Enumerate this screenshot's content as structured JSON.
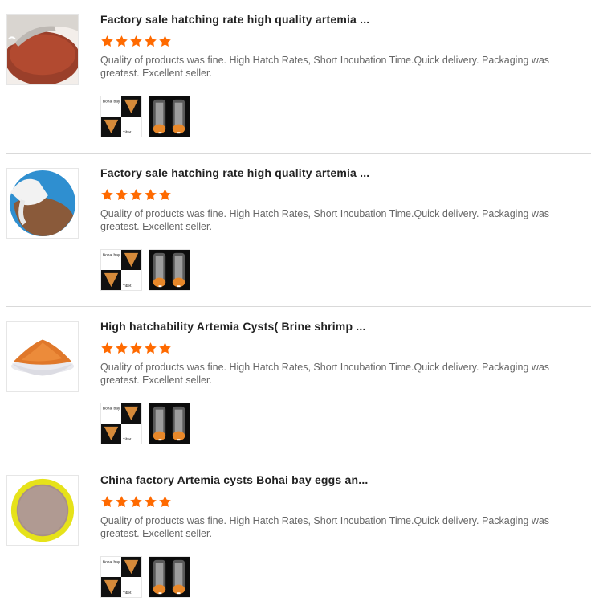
{
  "reviews": [
    {
      "title": "Factory sale hatching rate high quality artemia ...",
      "rating": 5,
      "text": "Quality of products was fine. High Hatch Rates, Short Incubation Time.Quick delivery. Packaging was greatest. Excellent seller.",
      "photo1_labels": [
        "Bohai bay",
        "Tibet"
      ]
    },
    {
      "title": "Factory sale hatching rate high quality artemia ...",
      "rating": 5,
      "text": "Quality of products was fine. High Hatch Rates, Short Incubation Time.Quick delivery. Packaging was greatest. Excellent seller.",
      "photo1_labels": [
        "Bohai bay",
        "Tibet"
      ]
    },
    {
      "title": "High hatchability Artemia Cysts( Brine shrimp ...",
      "rating": 5,
      "text": "Quality of products was fine. High Hatch Rates, Short Incubation Time.Quick delivery. Packaging was greatest. Excellent seller.",
      "photo1_labels": [
        "Bohai bay",
        "Tibet"
      ]
    },
    {
      "title": "China factory Artemia cysts Bohai bay eggs an...",
      "rating": 5,
      "text": "Quality of products was fine. High Hatch Rates, Short Incubation Time.Quick delivery. Packaging was greatest. Excellent seller.",
      "photo1_labels": [
        "Bohai bay",
        "Tibet"
      ]
    }
  ],
  "colors": {
    "star": "#ff6a00",
    "title": "#222222",
    "text": "#666666",
    "divider": "#d9d9d9"
  },
  "icons": {
    "star": "star-icon"
  }
}
